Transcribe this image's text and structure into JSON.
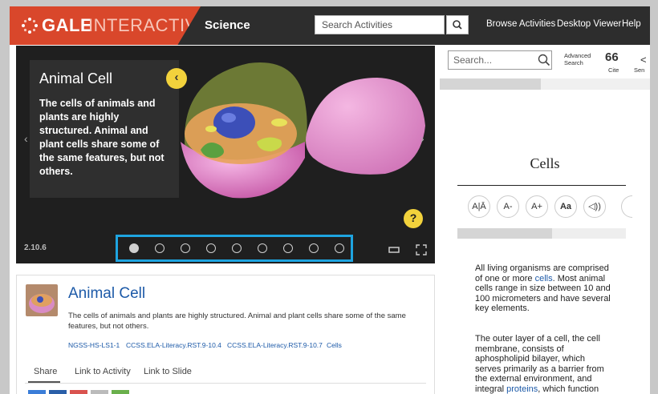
{
  "header": {
    "logo_gale": "GALE",
    "logo_interactive": "INTERACTIVE",
    "section": "Science",
    "search_placeholder": "Search Activities",
    "nav": [
      "Browse Activities",
      "Desktop Viewer",
      "Help"
    ]
  },
  "viewer": {
    "title": "Animal Cell",
    "body": "The cells of animals and plants are highly structured. Animal and plant cells share some of the same features, but not others.",
    "version": "2.10.6",
    "slide_count": 9,
    "active_slide": 1,
    "help_label": "?"
  },
  "card": {
    "title": "Animal Cell",
    "description": "The cells of animals and plants are highly structured. Animal and plant cells share some of the same features, but not others.",
    "standards": [
      "NGSS-HS-LS1-1",
      "CCSS.ELA-Literacy.RST.9-10.4",
      "CCSS.ELA-Literacy.RST.9-10.7",
      "Cells"
    ],
    "tabs": [
      "Share",
      "Link to Activity",
      "Link to Slide"
    ],
    "share_colors": [
      "#3b7dd8",
      "#2a5fa8",
      "#d9534f",
      "#bbbbbb",
      "#6ab04c"
    ]
  },
  "reader": {
    "search_placeholder": "Search...",
    "advanced_line1": "Advanced",
    "advanced_line2": "Search",
    "cite_label": "Cite",
    "send_label": "Sen",
    "doc_title": "Cells",
    "tools": [
      "A|Ā",
      "A-",
      "A+",
      "Aa",
      "◁))"
    ],
    "para1_pre": "All living organisms are comprised of one or more ",
    "para1_link": "cells",
    "para1_post": ". Most animal cells range in size between 10 and 100 micrometers and have several key elements.",
    "para2_pre": "The outer layer of a cell, the cell membrane, consists of aphospholipid bilayer, which serves primarily as a barrier from the external environment, and integral ",
    "para2_link": "proteins",
    "para2_post": ", which function mainly to regulate"
  }
}
